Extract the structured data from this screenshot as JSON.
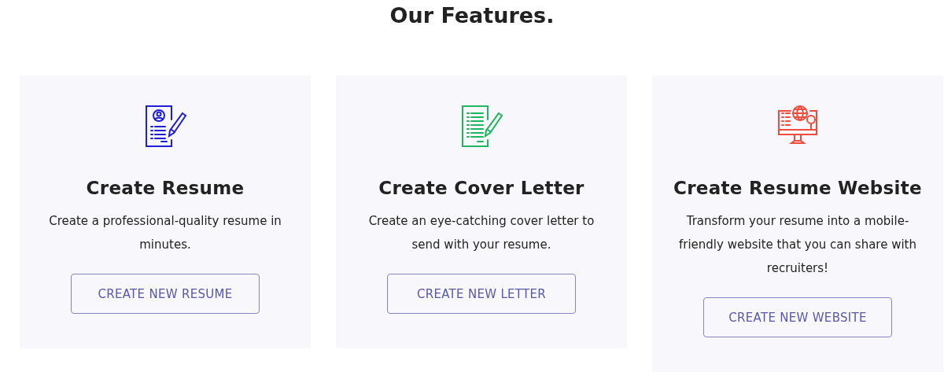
{
  "heading": "Our Features.",
  "features": [
    {
      "kind": "resume",
      "color": "#1f1fd6",
      "title": "Create Resume",
      "description": "Create a professional-quality resume in minutes.",
      "button": "CREATE NEW RESUME"
    },
    {
      "kind": "letter",
      "color": "#1fb561",
      "title": "Create Cover Letter",
      "description": "Create an eye-catching cover letter to send with your resume.",
      "button": "CREATE NEW LETTER"
    },
    {
      "kind": "website",
      "color": "#f04b3c",
      "title": "Create Resume Website",
      "description": "Transform your resume into a mobile-friendly website that you can share with recruiters!",
      "button": "CREATE NEW WEBSITE"
    }
  ]
}
